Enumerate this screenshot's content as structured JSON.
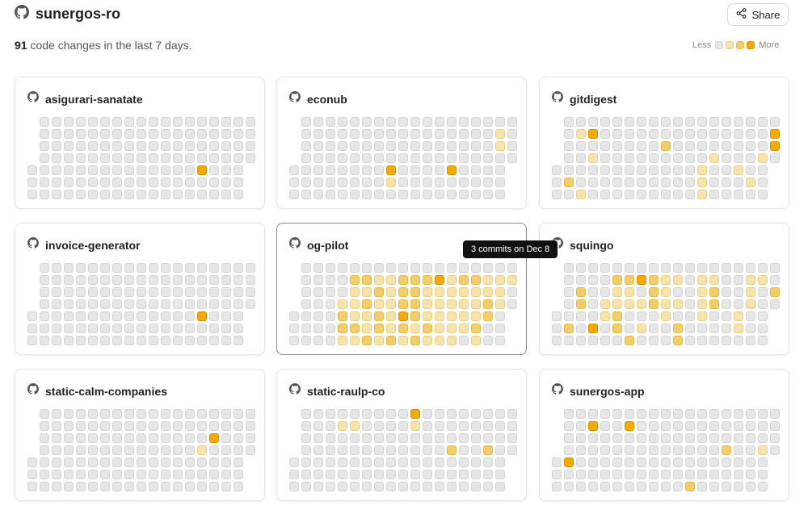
{
  "header": {
    "title": "sunergos-ro",
    "share_label": "Share"
  },
  "summary": {
    "count": "91",
    "text": "code changes in the last 7 days."
  },
  "legend": {
    "less": "Less",
    "more": "More"
  },
  "colors": {
    "empty": "#e6e6e6",
    "light": "#f6e2ab",
    "medium": "#f3cd6a",
    "dark": "#f5a905"
  },
  "tooltip": {
    "text": "3 commits on Dec 8"
  },
  "repos": [
    {
      "name": "asigurari-sanatate",
      "selected": false,
      "cells": [
        [
          4,
          14,
          3
        ]
      ]
    },
    {
      "name": "econub",
      "selected": false,
      "cells": [
        [
          1,
          17,
          1
        ],
        [
          2,
          17,
          1
        ],
        [
          4,
          8,
          3
        ],
        [
          4,
          13,
          3
        ],
        [
          5,
          8,
          1
        ]
      ]
    },
    {
      "name": "gitdigest",
      "selected": false,
      "cells": [
        [
          1,
          2,
          1
        ],
        [
          1,
          3,
          3
        ],
        [
          1,
          18,
          3
        ],
        [
          2,
          9,
          2
        ],
        [
          2,
          18,
          3
        ],
        [
          3,
          3,
          1
        ],
        [
          3,
          13,
          1
        ],
        [
          3,
          17,
          1
        ],
        [
          4,
          12,
          1
        ],
        [
          4,
          15,
          1
        ],
        [
          4,
          18,
          1
        ],
        [
          5,
          1,
          2
        ],
        [
          5,
          12,
          1
        ],
        [
          5,
          16,
          1
        ],
        [
          6,
          2,
          1
        ],
        [
          6,
          12,
          1
        ],
        [
          7,
          2,
          1
        ],
        [
          7,
          17,
          1
        ]
      ]
    },
    {
      "name": "invoice-generator",
      "selected": false,
      "cells": [
        [
          4,
          14,
          3
        ]
      ]
    },
    {
      "name": "og-pilot",
      "selected": false,
      "cells": [
        [
          1,
          5,
          2
        ],
        [
          1,
          6,
          2
        ],
        [
          1,
          7,
          1
        ],
        [
          1,
          8,
          1
        ],
        [
          1,
          9,
          2
        ],
        [
          1,
          10,
          2
        ],
        [
          1,
          11,
          2
        ],
        [
          1,
          12,
          3
        ],
        [
          1,
          13,
          1
        ],
        [
          1,
          14,
          2
        ],
        [
          1,
          15,
          2
        ],
        [
          1,
          16,
          1
        ],
        [
          1,
          17,
          1
        ],
        [
          1,
          18,
          1
        ],
        [
          2,
          5,
          1
        ],
        [
          2,
          6,
          1
        ],
        [
          2,
          7,
          2
        ],
        [
          2,
          8,
          1
        ],
        [
          2,
          9,
          2
        ],
        [
          2,
          10,
          2
        ],
        [
          2,
          11,
          1
        ],
        [
          2,
          12,
          1
        ],
        [
          2,
          13,
          1
        ],
        [
          2,
          14,
          1
        ],
        [
          2,
          15,
          1
        ],
        [
          2,
          16,
          1
        ],
        [
          2,
          17,
          1
        ],
        [
          3,
          4,
          1
        ],
        [
          3,
          5,
          1
        ],
        [
          3,
          6,
          2
        ],
        [
          3,
          7,
          1
        ],
        [
          3,
          8,
          1
        ],
        [
          3,
          9,
          2
        ],
        [
          3,
          10,
          2
        ],
        [
          3,
          11,
          1
        ],
        [
          3,
          12,
          1
        ],
        [
          3,
          13,
          1
        ],
        [
          3,
          14,
          1
        ],
        [
          3,
          15,
          1
        ],
        [
          3,
          16,
          2
        ],
        [
          3,
          17,
          1
        ],
        [
          4,
          4,
          2
        ],
        [
          4,
          5,
          1
        ],
        [
          4,
          6,
          1
        ],
        [
          4,
          7,
          2
        ],
        [
          4,
          8,
          1
        ],
        [
          4,
          9,
          3
        ],
        [
          4,
          10,
          2
        ],
        [
          4,
          11,
          1
        ],
        [
          4,
          12,
          1
        ],
        [
          4,
          13,
          1
        ],
        [
          4,
          14,
          1
        ],
        [
          4,
          15,
          1
        ],
        [
          4,
          16,
          2
        ],
        [
          5,
          4,
          2
        ],
        [
          5,
          5,
          2
        ],
        [
          5,
          6,
          1
        ],
        [
          5,
          7,
          2
        ],
        [
          5,
          8,
          1
        ],
        [
          5,
          9,
          2
        ],
        [
          5,
          10,
          1
        ],
        [
          5,
          11,
          2
        ],
        [
          5,
          12,
          1
        ],
        [
          5,
          13,
          1
        ],
        [
          5,
          14,
          1
        ],
        [
          5,
          15,
          2
        ],
        [
          6,
          4,
          1
        ],
        [
          6,
          5,
          1
        ],
        [
          6,
          6,
          2
        ],
        [
          6,
          7,
          1
        ],
        [
          6,
          8,
          2
        ],
        [
          6,
          9,
          1
        ],
        [
          6,
          10,
          2
        ],
        [
          6,
          11,
          1
        ],
        [
          6,
          12,
          1
        ],
        [
          6,
          13,
          1
        ],
        [
          6,
          15,
          1
        ],
        [
          7,
          4,
          1
        ],
        [
          7,
          5,
          1
        ],
        [
          7,
          6,
          1
        ],
        [
          7,
          7,
          1
        ],
        [
          7,
          8,
          1
        ],
        [
          7,
          9,
          1
        ],
        [
          7,
          10,
          1
        ],
        [
          7,
          11,
          1
        ],
        [
          7,
          12,
          1
        ],
        [
          7,
          15,
          2
        ]
      ]
    },
    {
      "name": "squingo",
      "selected": false,
      "cells": [
        [
          1,
          5,
          2
        ],
        [
          1,
          6,
          2
        ],
        [
          1,
          7,
          3
        ],
        [
          1,
          8,
          2
        ],
        [
          1,
          9,
          1
        ],
        [
          1,
          10,
          1
        ],
        [
          1,
          12,
          1
        ],
        [
          1,
          13,
          1
        ],
        [
          1,
          16,
          1
        ],
        [
          1,
          17,
          1
        ],
        [
          2,
          2,
          2
        ],
        [
          2,
          5,
          1
        ],
        [
          2,
          6,
          1
        ],
        [
          2,
          8,
          2
        ],
        [
          2,
          9,
          1
        ],
        [
          2,
          12,
          1
        ],
        [
          2,
          13,
          2
        ],
        [
          2,
          16,
          1
        ],
        [
          2,
          18,
          2
        ],
        [
          3,
          2,
          2
        ],
        [
          3,
          4,
          1
        ],
        [
          3,
          5,
          1
        ],
        [
          3,
          6,
          1
        ],
        [
          3,
          7,
          1
        ],
        [
          3,
          8,
          2
        ],
        [
          3,
          9,
          1
        ],
        [
          3,
          10,
          1
        ],
        [
          3,
          12,
          1
        ],
        [
          3,
          13,
          2
        ],
        [
          3,
          16,
          1
        ],
        [
          4,
          4,
          1
        ],
        [
          4,
          5,
          2
        ],
        [
          4,
          9,
          1
        ],
        [
          4,
          12,
          1
        ],
        [
          4,
          15,
          1
        ],
        [
          5,
          1,
          2
        ],
        [
          5,
          3,
          3
        ],
        [
          5,
          5,
          2
        ],
        [
          5,
          7,
          1
        ],
        [
          5,
          10,
          2
        ],
        [
          5,
          15,
          1
        ],
        [
          6,
          6,
          2
        ],
        [
          6,
          10,
          2
        ]
      ]
    },
    {
      "name": "static-calm-companies",
      "selected": false,
      "cells": [
        [
          2,
          15,
          3
        ],
        [
          3,
          14,
          1
        ]
      ]
    },
    {
      "name": "static-raulp-co",
      "selected": false,
      "cells": [
        [
          0,
          10,
          3
        ],
        [
          1,
          4,
          1
        ],
        [
          1,
          5,
          1
        ],
        [
          1,
          10,
          1
        ],
        [
          3,
          13,
          2
        ],
        [
          3,
          16,
          2
        ]
      ]
    },
    {
      "name": "sunergos-app",
      "selected": false,
      "cells": [
        [
          1,
          3,
          3
        ],
        [
          1,
          6,
          3
        ],
        [
          3,
          14,
          2
        ],
        [
          3,
          17,
          1
        ],
        [
          4,
          1,
          3
        ],
        [
          6,
          11,
          2
        ]
      ]
    }
  ]
}
